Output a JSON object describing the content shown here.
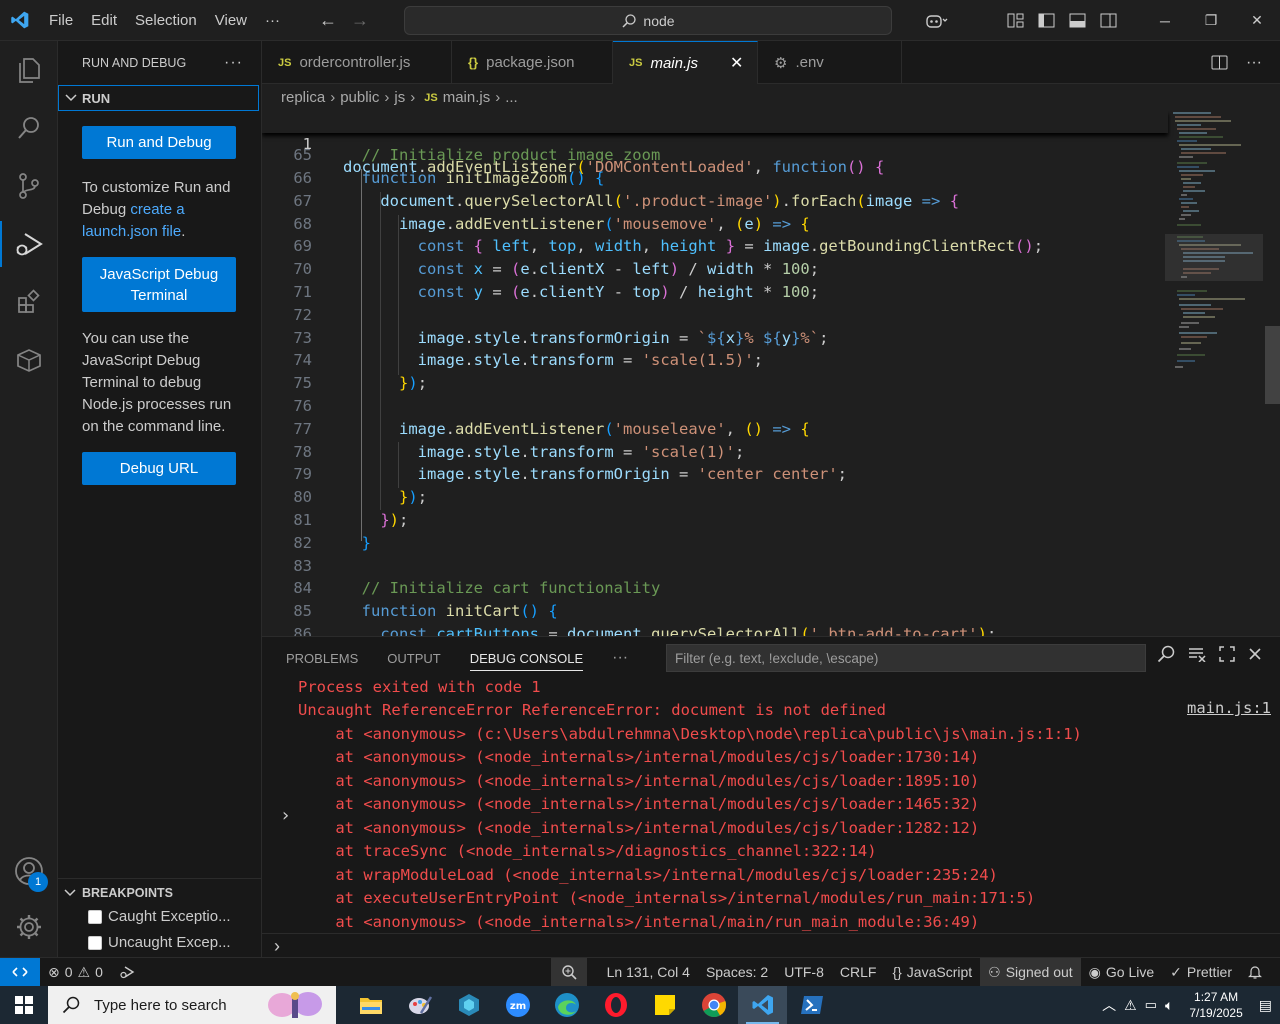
{
  "titlebar": {
    "menu": [
      "File",
      "Edit",
      "Selection",
      "View",
      "···"
    ],
    "search_text": "node"
  },
  "sidebar": {
    "title": "RUN AND DEBUG",
    "section": "RUN",
    "run_button": "Run and Debug",
    "customize_text_1": "To customize Run and Debug ",
    "customize_link": "create a launch.json file",
    "customize_text_2": ".",
    "terminal_button": "JavaScript Debug Terminal",
    "terminal_text": "You can use the JavaScript Debug Terminal to debug Node.js processes run on the command line.",
    "debug_url_button": "Debug URL",
    "breakpoints_title": "BREAKPOINTS",
    "breakpoints": [
      "Caught Exceptio...",
      "Uncaught Excep..."
    ]
  },
  "activity": {
    "badge": "1"
  },
  "tabs": [
    {
      "label": "ordercontroller.js",
      "type": "JS"
    },
    {
      "label": "package.json",
      "type": "{}"
    },
    {
      "label": "main.js",
      "type": "JS"
    },
    {
      "label": ".env",
      "type": "gear"
    }
  ],
  "breadcrumb": [
    "replica",
    "public",
    "js",
    "main.js",
    "..."
  ],
  "editor": {
    "sticky_line_number": "1",
    "line_numbers": [
      "65",
      "66",
      "67",
      "68",
      "69",
      "70",
      "71",
      "72",
      "73",
      "74",
      "75",
      "76",
      "77",
      "78",
      "79",
      "80",
      "81",
      "82",
      "83",
      "84",
      "85",
      "86"
    ]
  },
  "panel": {
    "tabs": [
      "PROBLEMS",
      "OUTPUT",
      "DEBUG CONSOLE",
      "···"
    ],
    "filter_placeholder": "Filter (e.g. text, !exclude, \\escape)",
    "console_lines": [
      "Process exited with code 1",
      "Uncaught ReferenceError ReferenceError: document is not defined",
      "    at <anonymous> (c:\\Users\\abdulrehmna\\Desktop\\node\\replica\\public\\js\\main.js:1:1)",
      "    at <anonymous> (<node_internals>/internal/modules/cjs/loader:1730:14)",
      "    at <anonymous> (<node_internals>/internal/modules/cjs/loader:1895:10)",
      "    at <anonymous> (<node_internals>/internal/modules/cjs/loader:1465:32)",
      "    at <anonymous> (<node_internals>/internal/modules/cjs/loader:1282:12)",
      "    at traceSync (<node_internals>/diagnostics_channel:322:14)",
      "    at wrapModuleLoad (<node_internals>/internal/modules/cjs/loader:235:24)",
      "    at executeUserEntryPoint (<node_internals>/internal/modules/run_main:171:5)",
      "    at <anonymous> (<node_internals>/internal/main/run_main_module:36:49)"
    ],
    "source_link": "main.js:1"
  },
  "statusbar": {
    "errors": "0",
    "warnings": "0",
    "position": "Ln 131, Col 4",
    "spaces": "Spaces: 2",
    "encoding": "UTF-8",
    "eol": "CRLF",
    "language": "JavaScript",
    "account": "Signed out",
    "golive": "Go Live",
    "prettier": "Prettier"
  },
  "taskbar": {
    "search_placeholder": "Type here to search",
    "time": "1:27 AM",
    "date": "7/19/2025"
  }
}
